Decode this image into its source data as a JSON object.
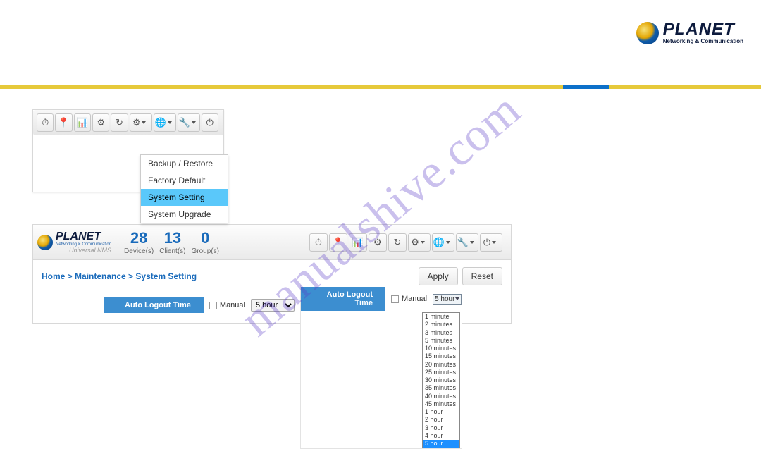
{
  "watermark": "manualshive.com",
  "brand": {
    "name": "PLANET",
    "tagline": "Networking & Communication",
    "subline": "Universal NMS"
  },
  "snippet_toolbar_icons": [
    "⏱",
    "📍",
    "📊",
    "⚙",
    "↻",
    "⚙",
    "🌐",
    "🔧",
    "⏻"
  ],
  "dropdown_menu": [
    "Backup / Restore",
    "Factory Default",
    "System Setting",
    "System Upgrade"
  ],
  "dropdown_selected": "System Setting",
  "reset_btn_short": "Res",
  "stats": [
    {
      "num": "28",
      "label": "Device(s)"
    },
    {
      "num": "13",
      "label": "Client(s)"
    },
    {
      "num": "0",
      "label": "Group(s)"
    }
  ],
  "breadcrumb": {
    "p0": "Home",
    "p1": "Maintenance",
    "p2": "System Setting",
    "sep": " > "
  },
  "buttons": {
    "apply": "Apply",
    "reset": "Reset"
  },
  "setting": {
    "label": "Auto Logout Time",
    "manual": "Manual",
    "selected": "5 hour"
  },
  "time_options": [
    "1 minute",
    "2 minutes",
    "3 minutes",
    "5 minutes",
    "10 minutes",
    "15 minutes",
    "20 minutes",
    "25 minutes",
    "30 minutes",
    "35 minutes",
    "40 minutes",
    "45 minutes",
    "1 hour",
    "2 hour",
    "3 hour",
    "4 hour",
    "5 hour"
  ]
}
